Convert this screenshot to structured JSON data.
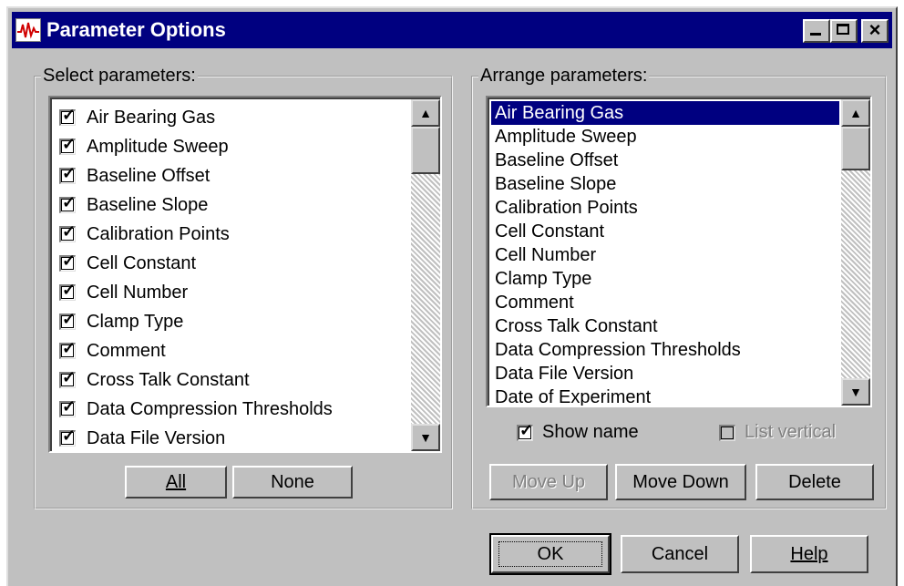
{
  "window": {
    "title": "Parameter Options",
    "icon": "waveform-app-icon",
    "controls": {
      "minimize": "_",
      "maximize": "□",
      "close": "×"
    }
  },
  "select_group": {
    "label": "Select parameters:",
    "items": [
      {
        "label": "Air Bearing Gas",
        "checked": true
      },
      {
        "label": "Amplitude Sweep",
        "checked": true
      },
      {
        "label": "Baseline Offset",
        "checked": true
      },
      {
        "label": "Baseline Slope",
        "checked": true
      },
      {
        "label": "Calibration Points",
        "checked": true
      },
      {
        "label": "Cell Constant",
        "checked": true
      },
      {
        "label": "Cell Number",
        "checked": true
      },
      {
        "label": "Clamp Type",
        "checked": true
      },
      {
        "label": "Comment",
        "checked": true
      },
      {
        "label": "Cross Talk Constant",
        "checked": true
      },
      {
        "label": "Data Compression Thresholds",
        "checked": true
      },
      {
        "label": "Data File Version",
        "checked": true
      }
    ],
    "all_button": "All",
    "none_button": "None"
  },
  "arrange_group": {
    "label": "Arrange parameters:",
    "items": [
      "Air Bearing Gas",
      "Amplitude Sweep",
      "Baseline Offset",
      "Baseline Slope",
      "Calibration Points",
      "Cell Constant",
      "Cell Number",
      "Clamp Type",
      "Comment",
      "Cross Talk Constant",
      "Data Compression Thresholds",
      "Data File Version",
      "Date of Experiment"
    ],
    "selected": "Air Bearing Gas",
    "show_name": {
      "label": "Show name",
      "checked": true
    },
    "list_vertical": {
      "label": "List vertical",
      "checked": false,
      "enabled": false
    },
    "move_up_button": "Move Up",
    "move_down_button": "Move Down",
    "delete_button": "Delete"
  },
  "footer": {
    "ok_button": "OK",
    "cancel_button": "Cancel",
    "help_button": "Help"
  },
  "colors": {
    "titlebar": "#000080",
    "dialog_face": "#c0c0c0",
    "selection": "#000080"
  }
}
